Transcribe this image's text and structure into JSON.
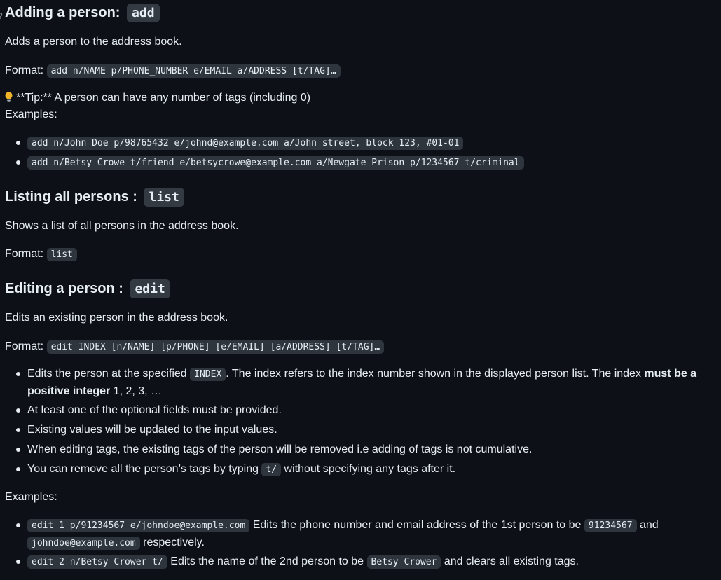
{
  "add_section": {
    "heading": "Adding a person:",
    "heading_code": "add",
    "description": "Adds a person to the address book.",
    "format_label": "Format:",
    "format_code": "add n/NAME p/PHONE_NUMBER e/EMAIL a/ADDRESS [t/TAG]…",
    "tip": "**Tip:** A person can have any number of tags (including 0)",
    "examples_label": "Examples:",
    "examples": [
      "add n/John Doe p/98765432 e/johnd@example.com a/John street, block 123, #01-01",
      "add n/Betsy Crowe t/friend e/betsycrowe@example.com a/Newgate Prison p/1234567 t/criminal"
    ]
  },
  "list_section": {
    "heading": "Listing all persons :",
    "heading_code": "list",
    "description": "Shows a list of all persons in the address book.",
    "format_label": "Format:",
    "format_code": "list"
  },
  "edit_section": {
    "heading": "Editing a person :",
    "heading_code": "edit",
    "description": "Edits an existing person in the address book.",
    "format_label": "Format:",
    "format_code": "edit INDEX [n/NAME] [p/PHONE] [e/EMAIL] [a/ADDRESS] [t/TAG]…",
    "bullet1": {
      "pre": "Edits the person at the specified",
      "code": "INDEX",
      "mid": ". The index refers to the index number shown in the displayed person list. The index",
      "bold": "must be a positive integer",
      "post": "1, 2, 3, …"
    },
    "bullet2": "At least one of the optional fields must be provided.",
    "bullet3": "Existing values will be updated to the input values.",
    "bullet4": "When editing tags, the existing tags of the person will be removed i.e adding of tags is not cumulative.",
    "bullet5": {
      "pre": "You can remove all the person’s tags by typing",
      "code": "t/",
      "post": "without specifying any tags after it."
    },
    "examples_label": "Examples:",
    "example1": {
      "code": "edit 1 p/91234567 e/johndoe@example.com",
      "pre": "Edits the phone number and email address of the 1st person to be",
      "code2": "91234567",
      "and": "and",
      "code3": "johndoe@example.com",
      "post": "respectively."
    },
    "example2": {
      "code": "edit 2 n/Betsy Crower t/",
      "pre": "Edits the name of the 2nd person to be",
      "code2": "Betsy Crower",
      "post": "and clears all existing tags."
    }
  },
  "colors": {
    "background": "#0d1117",
    "text": "#e6edf3",
    "code_background": "#2f353d",
    "bulb": "#f0b429"
  }
}
